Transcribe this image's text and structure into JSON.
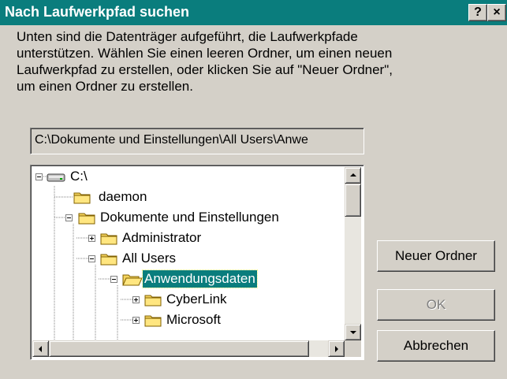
{
  "window": {
    "title": "Nach Laufwerkpfad suchen",
    "help_label": "?",
    "close_label": "×"
  },
  "description": "Unten sind die Datenträger aufgeführt, die Laufwerkpfade\nunterstützen. Wählen Sie einen leeren Ordner, um einen neuen\nLaufwerkpfad zu erstellen, oder klicken Sie auf \"Neuer Ordner\",\num einen Ordner zu erstellen.",
  "path_field": {
    "value": "C:\\Dokumente und Einstellungen\\All Users\\Anwe"
  },
  "tree": {
    "nodes": [
      {
        "label": "C:\\",
        "icon": "drive-icon",
        "expander": "minus"
      },
      {
        "label": "daemon",
        "icon": "folder-icon",
        "expander": "none"
      },
      {
        "label": "Dokumente und Einstellungen",
        "icon": "folder-icon",
        "expander": "minus"
      },
      {
        "label": "Administrator",
        "icon": "folder-icon",
        "expander": "plus"
      },
      {
        "label": "All Users",
        "icon": "folder-icon",
        "expander": "minus"
      },
      {
        "label": "Anwendungsdaten",
        "icon": "open-folder-icon",
        "expander": "minus",
        "selected": true
      },
      {
        "label": "CyberLink",
        "icon": "folder-icon",
        "expander": "plus"
      },
      {
        "label": "Microsoft",
        "icon": "folder-icon",
        "expander": "plus"
      }
    ]
  },
  "buttons": {
    "new_folder": "Neuer Ordner",
    "ok": "OK",
    "cancel": "Abbrechen"
  },
  "colors": {
    "titlebar": "#0a7d7d",
    "selection": "#0a7d7d",
    "face": "#d4d0c8"
  }
}
